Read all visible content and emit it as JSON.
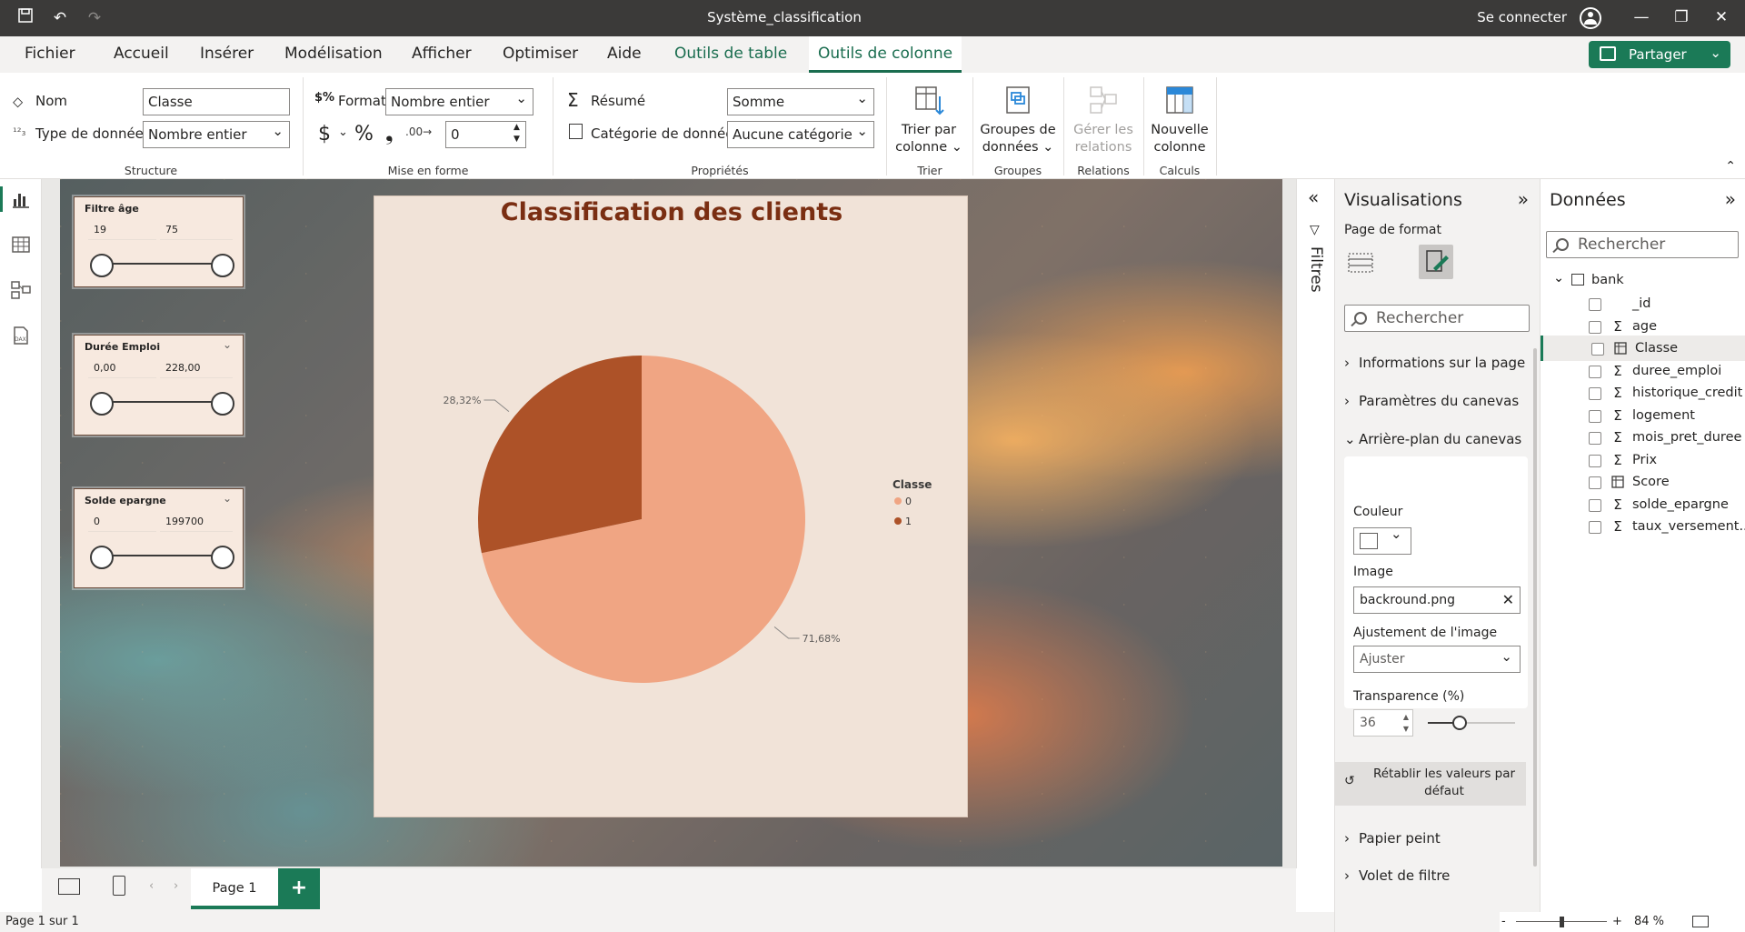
{
  "titlebar": {
    "title": "Système_classification",
    "signin": "Se connecter"
  },
  "menu": {
    "items": [
      "Fichier",
      "Accueil",
      "Insérer",
      "Modélisation",
      "Afficher",
      "Optimiser",
      "Aide"
    ],
    "ctx_table": "Outils de table",
    "ctx_column": "Outils de colonne",
    "share": "Partager"
  },
  "ribbon": {
    "nom_label": "Nom",
    "nom_value": "Classe",
    "type_label": "Type de données",
    "type_value": "Nombre entier",
    "structure": "Structure",
    "format_label": "Format",
    "format_value": "Nombre entier",
    "currency": "$",
    "percent": "%",
    "comma": "❟",
    "decimals_value": "0",
    "mise_en_forme": "Mise en forme",
    "resume_label": "Résumé",
    "resume_value": "Somme",
    "categorie_label": "Catégorie de données",
    "categorie_value": "Aucune catégorie",
    "proprietes": "Propriétés",
    "trier_line1": "Trier par",
    "trier_line2": "colonne",
    "trier_group": "Trier",
    "groupes_line1": "Groupes de",
    "groupes_line2": "données",
    "groupes_group": "Groupes",
    "relations_line1": "Gérer les",
    "relations_line2": "relations",
    "relations_group": "Relations",
    "nouvelle_line1": "Nouvelle",
    "nouvelle_line2": "colonne",
    "calculs_group": "Calculs"
  },
  "slicers": [
    {
      "title": "Filtre âge",
      "min": "19",
      "max": "75"
    },
    {
      "title": "Durée Emploi",
      "min": "0,00",
      "max": "228,00"
    },
    {
      "title": "Solde epargne",
      "min": "0",
      "max": "199700"
    }
  ],
  "chart_data": {
    "type": "pie",
    "title": "Classification des clients",
    "legend_title": "Classe",
    "legend_position": "right",
    "slices": [
      {
        "name": "0",
        "value": 71.68,
        "label": "71,68%",
        "color": "#f0a583"
      },
      {
        "name": "1",
        "value": 28.32,
        "label": "28,32%",
        "color": "#ad5228"
      }
    ]
  },
  "filters_label": "Filtres",
  "viz": {
    "title": "Visualisations",
    "subtitle": "Page de format",
    "search": "Rechercher",
    "sections": [
      "Informations sur la page",
      "Paramètres du canevas",
      "Arrière-plan du canevas"
    ],
    "couleur_label": "Couleur",
    "image_label": "Image",
    "image_value": "backround.png",
    "ajustement_label": "Ajustement de l'image",
    "ajustement_value": "Ajuster",
    "transparence_label": "Transparence (%)",
    "transparence_value": "36",
    "transparence_level": 36,
    "reset_line1": "Rétablir les valeurs par",
    "reset_line2": "défaut",
    "sections_after": [
      "Papier peint",
      "Volet de filtre"
    ]
  },
  "data_pane": {
    "title": "Données",
    "search": "Rechercher",
    "table": "bank",
    "fields": [
      {
        "name": "_id",
        "icon": ""
      },
      {
        "name": "age",
        "icon": "Σ"
      },
      {
        "name": "Classe",
        "icon": "calc"
      },
      {
        "name": "duree_emploi",
        "icon": "Σ"
      },
      {
        "name": "historique_credit",
        "icon": "Σ"
      },
      {
        "name": "logement",
        "icon": "Σ"
      },
      {
        "name": "mois_pret_duree",
        "icon": "Σ"
      },
      {
        "name": "Prix",
        "icon": "Σ"
      },
      {
        "name": "Score",
        "icon": "calc"
      },
      {
        "name": "solde_epargne",
        "icon": "Σ"
      },
      {
        "name": "taux_versement...",
        "icon": "Σ"
      }
    ]
  },
  "pages": {
    "tab": "Page 1",
    "add": "+"
  },
  "status": {
    "page": "Page 1 sur 1",
    "zoom": "84 %",
    "zoom_minus": "-",
    "zoom_plus": "+"
  }
}
